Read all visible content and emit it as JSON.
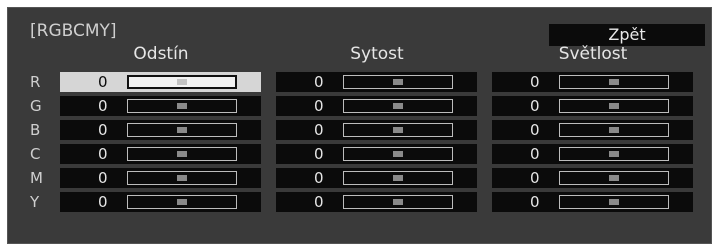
{
  "title": "[RGBCMY]",
  "back_button": "Zpět",
  "columns": [
    "Odstín",
    "Sytost",
    "Světlost"
  ],
  "rows": [
    {
      "label": "R",
      "values": [
        0,
        0,
        0
      ],
      "levels": [
        0.5,
        0.5,
        0.5
      ]
    },
    {
      "label": "G",
      "values": [
        0,
        0,
        0
      ],
      "levels": [
        0.5,
        0.5,
        0.5
      ]
    },
    {
      "label": "B",
      "values": [
        0,
        0,
        0
      ],
      "levels": [
        0.5,
        0.5,
        0.5
      ]
    },
    {
      "label": "C",
      "values": [
        0,
        0,
        0
      ],
      "levels": [
        0.5,
        0.5,
        0.5
      ]
    },
    {
      "label": "M",
      "values": [
        0,
        0,
        0
      ],
      "levels": [
        0.5,
        0.5,
        0.5
      ]
    },
    {
      "label": "Y",
      "values": [
        0,
        0,
        0
      ],
      "levels": [
        0.5,
        0.5,
        0.5
      ]
    }
  ],
  "selected": {
    "row": 0,
    "column": 0
  },
  "colors": {
    "panel": "#3a3a3a",
    "cell": "#0b0b0b",
    "selected_cell": "#d6d6d6",
    "text": "#e6e6e6"
  }
}
